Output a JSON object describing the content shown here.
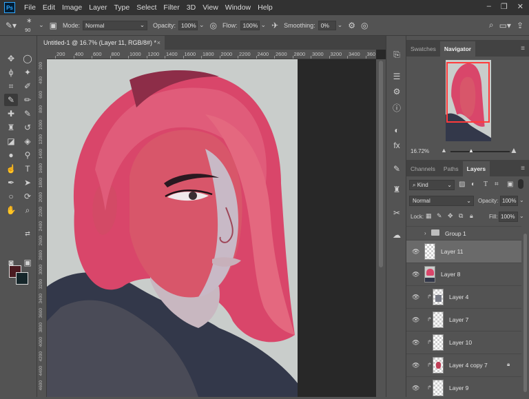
{
  "app": {
    "logo": "Ps",
    "menu": [
      "File",
      "Edit",
      "Image",
      "Layer",
      "Type",
      "Select",
      "Filter",
      "3D",
      "View",
      "Window",
      "Help"
    ],
    "window_controls": [
      "–",
      "❐",
      "✕"
    ]
  },
  "options_bar": {
    "brush_size": "90",
    "mode_label": "Mode:",
    "mode_value": "Normal",
    "opacity_label": "Opacity:",
    "opacity_value": "100%",
    "flow_label": "Flow:",
    "flow_value": "100%",
    "smoothing_label": "Smoothing:",
    "smoothing_value": "0%"
  },
  "document": {
    "tab_title": "Untitled-1 @ 16.7% (Layer 11, RGB/8#) *",
    "close_glyph": "×",
    "ruler_h_labels": [
      "200",
      "400",
      "600",
      "800",
      "1000",
      "1200",
      "1400",
      "1600",
      "1800",
      "2000",
      "2200",
      "2400",
      "2600",
      "2800",
      "3000",
      "3200",
      "3400",
      "360"
    ],
    "ruler_v_labels": [
      "200",
      "400",
      "600",
      "800",
      "1000",
      "1200",
      "1400",
      "1600",
      "1800",
      "2000",
      "2200",
      "2400",
      "2600",
      "2800",
      "3000",
      "3200",
      "3400",
      "3600",
      "3800",
      "4000",
      "4200",
      "4400",
      "4600"
    ]
  },
  "colors": {
    "foreground": "#4a1a20",
    "background": "#16262a",
    "hair": "#e4546e",
    "skin": "#d8566a",
    "jacket": "#33384a",
    "canvas_bg": "#c9cdcb"
  },
  "panels": {
    "top_tabs": [
      "Swatches",
      "Navigator"
    ],
    "navigator_zoom": "16.72%",
    "mid_tabs": [
      "Channels",
      "Paths",
      "Layers"
    ],
    "kind_label": "Kind",
    "blend_mode": "Normal",
    "opacity_label": "Opacity:",
    "opacity_value": "100%",
    "lock_label": "Lock:",
    "fill_label": "Fill:",
    "fill_value": "100%",
    "layers": [
      {
        "name": "Group 1",
        "type": "group"
      },
      {
        "name": "Layer 11",
        "type": "layer",
        "selected": true
      },
      {
        "name": "Layer 8",
        "type": "image"
      },
      {
        "name": "Layer 4",
        "type": "clipped"
      },
      {
        "name": "Layer 7",
        "type": "clipped"
      },
      {
        "name": "Layer 10",
        "type": "clipped"
      },
      {
        "name": "Layer 4 copy 7",
        "type": "clipped",
        "locked": true
      },
      {
        "name": "Layer 9",
        "type": "clipped"
      }
    ]
  }
}
